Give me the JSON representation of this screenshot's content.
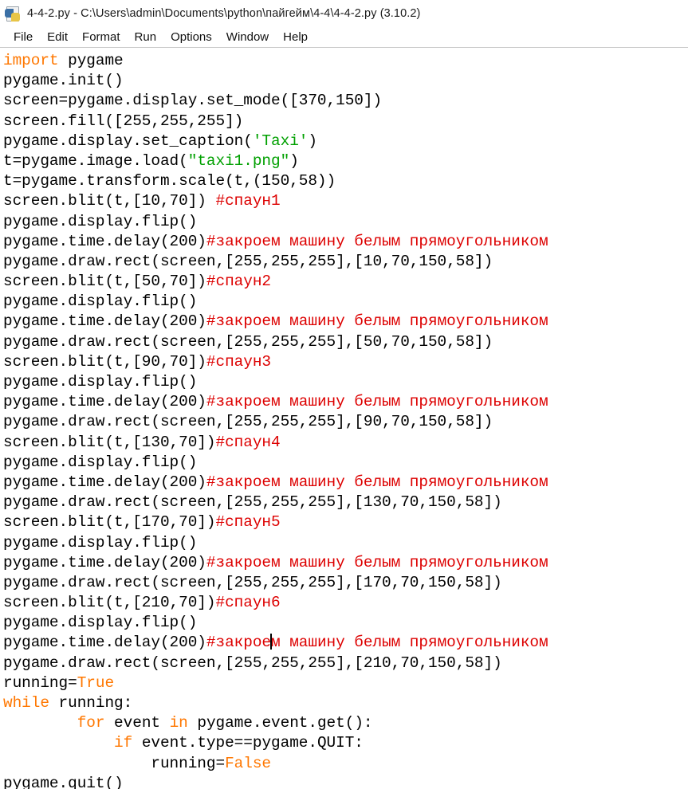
{
  "window": {
    "title": "4-4-2.py - C:\\Users\\admin\\Documents\\python\\пайгейм\\4-4\\4-4-2.py (3.10.2)",
    "icon": "python-idle-icon"
  },
  "menubar": {
    "items": [
      {
        "label": "File"
      },
      {
        "label": "Edit"
      },
      {
        "label": "Format"
      },
      {
        "label": "Run"
      },
      {
        "label": "Options"
      },
      {
        "label": "Window"
      },
      {
        "label": "Help"
      }
    ]
  },
  "colors": {
    "keyword": "#ff7700",
    "builtin": "#ff7700",
    "string": "#00a000",
    "comment": "#dd0000",
    "definition": "#0000ff",
    "text": "#000000",
    "background": "#ffffff"
  },
  "editor": {
    "caret_line": 33,
    "caret_column": 31,
    "lines": [
      {
        "n": 1,
        "tokens": [
          {
            "t": "kw",
            "s": "import"
          },
          {
            "t": "plain",
            "s": " pygame"
          }
        ]
      },
      {
        "n": 2,
        "tokens": [
          {
            "t": "plain",
            "s": "pygame.init()"
          }
        ]
      },
      {
        "n": 3,
        "tokens": [
          {
            "t": "plain",
            "s": "screen=pygame.display.set_mode([370,150])"
          }
        ]
      },
      {
        "n": 4,
        "tokens": [
          {
            "t": "plain",
            "s": "screen.fill([255,255,255])"
          }
        ]
      },
      {
        "n": 5,
        "tokens": [
          {
            "t": "plain",
            "s": "pygame.display.set_caption("
          },
          {
            "t": "str",
            "s": "'Taxi'"
          },
          {
            "t": "plain",
            "s": ")"
          }
        ]
      },
      {
        "n": 6,
        "tokens": [
          {
            "t": "plain",
            "s": "t=pygame.image.load("
          },
          {
            "t": "str",
            "s": "\"taxi1.png\""
          },
          {
            "t": "plain",
            "s": ")"
          }
        ]
      },
      {
        "n": 7,
        "tokens": [
          {
            "t": "plain",
            "s": "t=pygame.transform.scale(t,(150,58))"
          }
        ]
      },
      {
        "n": 8,
        "tokens": [
          {
            "t": "plain",
            "s": "screen.blit(t,[10,70]) "
          },
          {
            "t": "com",
            "s": "#спаун1"
          }
        ]
      },
      {
        "n": 9,
        "tokens": [
          {
            "t": "plain",
            "s": "pygame.display.flip()"
          }
        ]
      },
      {
        "n": 10,
        "tokens": [
          {
            "t": "plain",
            "s": "pygame.time.delay(200)"
          },
          {
            "t": "com",
            "s": "#закроем машину белым прямоугольником"
          }
        ]
      },
      {
        "n": 11,
        "tokens": [
          {
            "t": "plain",
            "s": "pygame.draw.rect(screen,[255,255,255],[10,70,150,58])"
          }
        ]
      },
      {
        "n": 12,
        "tokens": [
          {
            "t": "plain",
            "s": "screen.blit(t,[50,70])"
          },
          {
            "t": "com",
            "s": "#спаун2"
          }
        ]
      },
      {
        "n": 13,
        "tokens": [
          {
            "t": "plain",
            "s": "pygame.display.flip()"
          }
        ]
      },
      {
        "n": 14,
        "tokens": [
          {
            "t": "plain",
            "s": "pygame.time.delay(200)"
          },
          {
            "t": "com",
            "s": "#закроем машину белым прямоугольником"
          }
        ]
      },
      {
        "n": 15,
        "tokens": [
          {
            "t": "plain",
            "s": "pygame.draw.rect(screen,[255,255,255],[50,70,150,58])"
          }
        ]
      },
      {
        "n": 16,
        "tokens": [
          {
            "t": "plain",
            "s": "screen.blit(t,[90,70])"
          },
          {
            "t": "com",
            "s": "#спаун3"
          }
        ]
      },
      {
        "n": 17,
        "tokens": [
          {
            "t": "plain",
            "s": "pygame.display.flip()"
          }
        ]
      },
      {
        "n": 18,
        "tokens": [
          {
            "t": "plain",
            "s": "pygame.time.delay(200)"
          },
          {
            "t": "com",
            "s": "#закроем машину белым прямоугольником"
          }
        ]
      },
      {
        "n": 19,
        "tokens": [
          {
            "t": "plain",
            "s": "pygame.draw.rect(screen,[255,255,255],[90,70,150,58])"
          }
        ]
      },
      {
        "n": 20,
        "tokens": [
          {
            "t": "plain",
            "s": "screen.blit(t,[130,70])"
          },
          {
            "t": "com",
            "s": "#спаун4"
          }
        ]
      },
      {
        "n": 21,
        "tokens": [
          {
            "t": "plain",
            "s": "pygame.display.flip()"
          }
        ]
      },
      {
        "n": 22,
        "tokens": [
          {
            "t": "plain",
            "s": "pygame.time.delay(200)"
          },
          {
            "t": "com",
            "s": "#закроем машину белым прямоугольником"
          }
        ]
      },
      {
        "n": 23,
        "tokens": [
          {
            "t": "plain",
            "s": "pygame.draw.rect(screen,[255,255,255],[130,70,150,58])"
          }
        ]
      },
      {
        "n": 24,
        "tokens": [
          {
            "t": "plain",
            "s": "screen.blit(t,[170,70])"
          },
          {
            "t": "com",
            "s": "#спаун5"
          }
        ]
      },
      {
        "n": 25,
        "tokens": [
          {
            "t": "plain",
            "s": "pygame.display.flip()"
          }
        ]
      },
      {
        "n": 26,
        "tokens": [
          {
            "t": "plain",
            "s": "pygame.time.delay(200)"
          },
          {
            "t": "com",
            "s": "#закроем машину белым прямоугольником"
          }
        ]
      },
      {
        "n": 27,
        "tokens": [
          {
            "t": "plain",
            "s": "pygame.draw.rect(screen,[255,255,255],[170,70,150,58])"
          }
        ]
      },
      {
        "n": 28,
        "tokens": [
          {
            "t": "plain",
            "s": "screen.blit(t,[210,70])"
          },
          {
            "t": "com",
            "s": "#спаун6"
          }
        ]
      },
      {
        "n": 29,
        "tokens": [
          {
            "t": "plain",
            "s": "pygame.display.flip()"
          }
        ]
      },
      {
        "n": 30,
        "tokens": [
          {
            "t": "plain",
            "s": "pygame.time.delay(200)"
          },
          {
            "t": "com",
            "s": "#закрое"
          },
          {
            "t": "caret",
            "s": ""
          },
          {
            "t": "com",
            "s": "м машину белым прямоугольником"
          }
        ]
      },
      {
        "n": 31,
        "tokens": [
          {
            "t": "plain",
            "s": "pygame.draw.rect(screen,[255,255,255],[210,70,150,58])"
          }
        ]
      },
      {
        "n": 32,
        "tokens": [
          {
            "t": "plain",
            "s": "running="
          },
          {
            "t": "bi",
            "s": "True"
          }
        ]
      },
      {
        "n": 33,
        "tokens": [
          {
            "t": "kw",
            "s": "while"
          },
          {
            "t": "plain",
            "s": " running:"
          }
        ]
      },
      {
        "n": 34,
        "tokens": [
          {
            "t": "plain",
            "s": "        "
          },
          {
            "t": "kw",
            "s": "for"
          },
          {
            "t": "plain",
            "s": " event "
          },
          {
            "t": "kw",
            "s": "in"
          },
          {
            "t": "plain",
            "s": " pygame.event.get():"
          }
        ]
      },
      {
        "n": 35,
        "tokens": [
          {
            "t": "plain",
            "s": "            "
          },
          {
            "t": "kw",
            "s": "if"
          },
          {
            "t": "plain",
            "s": " event.type==pygame.QUIT:"
          }
        ]
      },
      {
        "n": 36,
        "tokens": [
          {
            "t": "plain",
            "s": "                running="
          },
          {
            "t": "bi",
            "s": "False"
          }
        ]
      },
      {
        "n": 37,
        "tokens": [
          {
            "t": "plain",
            "s": "pygame.quit()"
          }
        ]
      }
    ]
  }
}
